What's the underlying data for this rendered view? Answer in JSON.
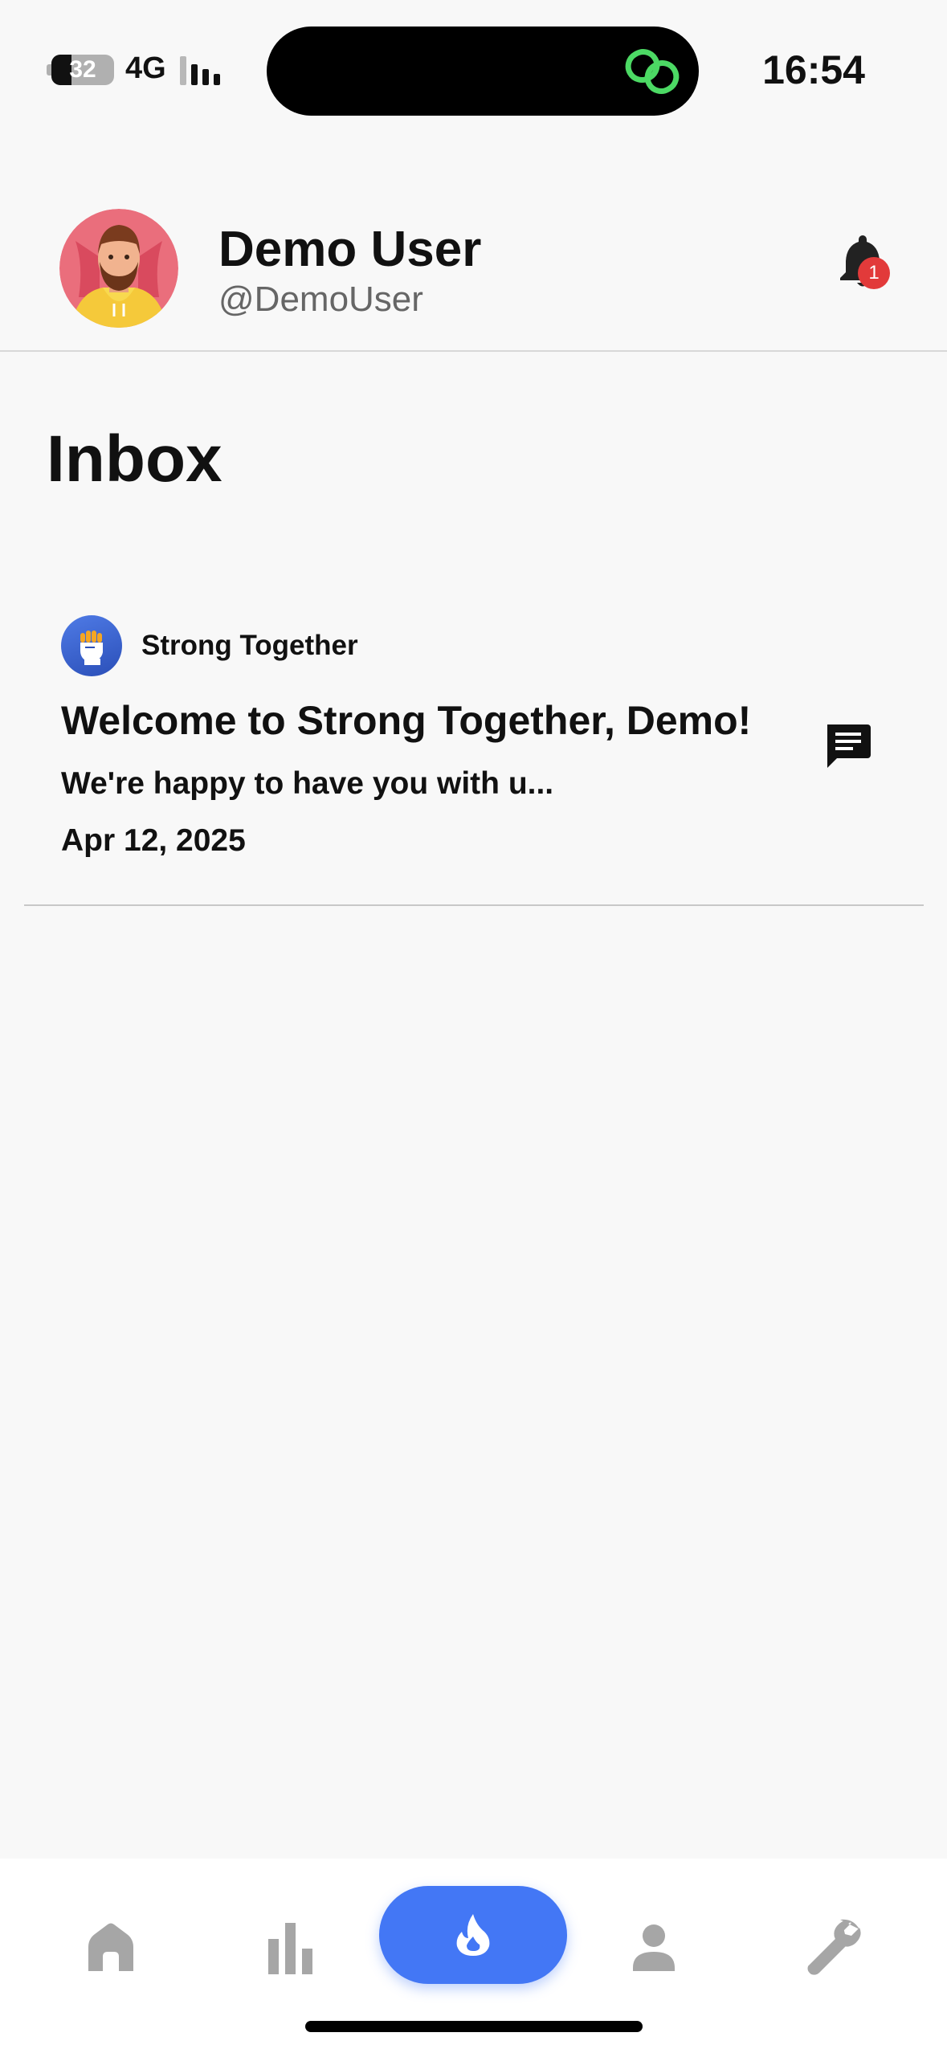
{
  "status_bar": {
    "battery_percent": "32",
    "battery_level": 0.32,
    "network": "4G",
    "time": "16:54"
  },
  "profile": {
    "name": "Demo User",
    "handle": "@DemoUser",
    "notification_count": "1"
  },
  "inbox": {
    "title": "Inbox",
    "messages": [
      {
        "group_name": "Strong Together",
        "title": "Welcome to Strong Together, Demo!",
        "preview": "We're happy to have you with u...",
        "date": "Apr 12, 2025"
      }
    ]
  },
  "bottom_nav": {
    "items": [
      {
        "icon": "home-icon"
      },
      {
        "icon": "bar-chart-icon"
      },
      {
        "icon": "flame-icon",
        "active": true
      },
      {
        "icon": "person-icon"
      },
      {
        "icon": "wrench-icon"
      }
    ]
  },
  "colors": {
    "accent": "#4377f5",
    "badge": "#e23a3a",
    "link_icon": "#4cd964",
    "inactive_nav": "#a6a6a6"
  }
}
